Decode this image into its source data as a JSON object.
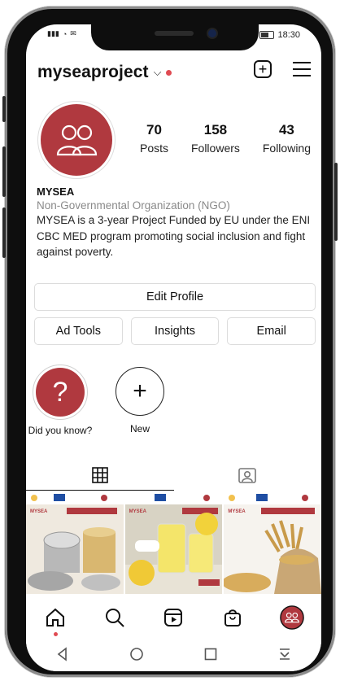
{
  "status_bar": {
    "left_icons": [
      "signal-icon",
      "wifi-icon",
      "mail-icon"
    ],
    "time": "18:30"
  },
  "header": {
    "username": "myseaproject",
    "dropdown_icon": "chevron-down-icon",
    "add_icon": "plus-square-icon",
    "menu_icon": "hamburger-menu-icon"
  },
  "profile": {
    "avatar_icon": "two-people-icon",
    "stats": [
      {
        "value": "70",
        "label": "Posts"
      },
      {
        "value": "158",
        "label": "Followers"
      },
      {
        "value": "43",
        "label": "Following"
      }
    ],
    "name": "MYSEA",
    "category": "Non-Governmental Organization (NGO)",
    "bio": "MYSEA is a 3-year Project Funded by EU under the ENI CBC MED program promoting social inclusion and fight against poverty."
  },
  "actions": {
    "edit_profile": "Edit Profile",
    "ad_tools": "Ad Tools",
    "insights": "Insights",
    "email": "Email"
  },
  "highlights": [
    {
      "label": "Did you know?",
      "glyph": "?"
    },
    {
      "label": "New",
      "glyph": "+"
    }
  ],
  "tabs": [
    {
      "icon": "grid-icon",
      "active": true
    },
    {
      "icon": "tagged-person-icon",
      "active": false
    }
  ],
  "posts": [
    {
      "brand": "MYSEA",
      "theme": "canned-food"
    },
    {
      "brand": "MYSEA",
      "theme": "lemonade"
    },
    {
      "brand": "MYSEA",
      "theme": "wheat-grain"
    }
  ],
  "bottom_nav": [
    "home-icon",
    "search-icon",
    "reels-icon",
    "shop-bag-icon",
    "profile-avatar-icon"
  ],
  "android_nav": [
    "back-icon",
    "home-circle-icon",
    "recents-icon",
    "notification-pull-icon"
  ],
  "colors": {
    "brand": "#b0393f",
    "accent_dot": "#e04a52"
  }
}
